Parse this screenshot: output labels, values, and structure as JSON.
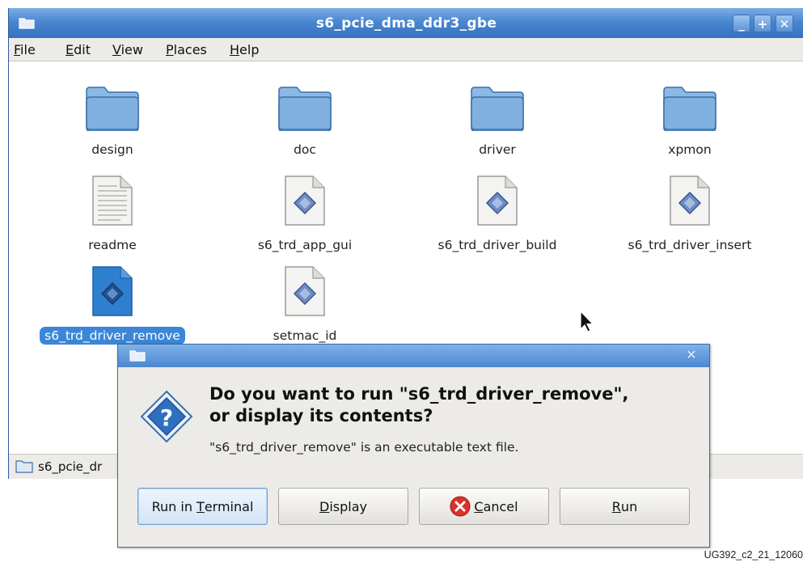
{
  "window": {
    "title": "s6_pcie_dma_ddr3_gbe",
    "controls": {
      "minimize": "_",
      "maximize": "+",
      "close": "✕"
    }
  },
  "menu": [
    {
      "key": "F",
      "rest": "ile"
    },
    {
      "key": "E",
      "rest": "dit"
    },
    {
      "key": "V",
      "rest": "iew"
    },
    {
      "key": "P",
      "rest": "laces"
    },
    {
      "key": "H",
      "rest": "elp"
    }
  ],
  "files": [
    {
      "name": "design",
      "icon": "folder-icon"
    },
    {
      "name": "doc",
      "icon": "folder-icon"
    },
    {
      "name": "driver",
      "icon": "folder-icon"
    },
    {
      "name": "xpmon",
      "icon": "folder-icon"
    },
    {
      "name": "readme",
      "icon": "text-document-icon"
    },
    {
      "name": "s6_trd_app_gui",
      "icon": "script-icon"
    },
    {
      "name": "s6_trd_driver_build",
      "icon": "script-icon"
    },
    {
      "name": "s6_trd_driver_insert",
      "icon": "script-icon"
    },
    {
      "name": "s6_trd_driver_remove",
      "icon": "script-icon",
      "selected": true
    },
    {
      "name": "setmac_id",
      "icon": "script-icon"
    }
  ],
  "statusbar": {
    "text": "s6_pcie_dr"
  },
  "dialog": {
    "close": "✕",
    "heading_line1": "Do you want to run \"s6_trd_driver_remove\",",
    "heading_line2": "or display its contents?",
    "message": "\"s6_trd_driver_remove\" is an executable text file.",
    "buttons": {
      "run_in_terminal": {
        "pre": "Run in ",
        "key": "T",
        "post": "erminal"
      },
      "display": {
        "pre": "",
        "key": "D",
        "post": "isplay"
      },
      "cancel": {
        "pre": "",
        "key": "C",
        "post": "ancel"
      },
      "run": {
        "pre": "",
        "key": "R",
        "post": "un"
      }
    }
  },
  "caption": "UG392_c2_21_12060",
  "colors": {
    "titlebar": "#4a87d0",
    "selection": "#3b86d6",
    "folder": "#7fb0e0",
    "cancel_icon": "#d9322c"
  }
}
